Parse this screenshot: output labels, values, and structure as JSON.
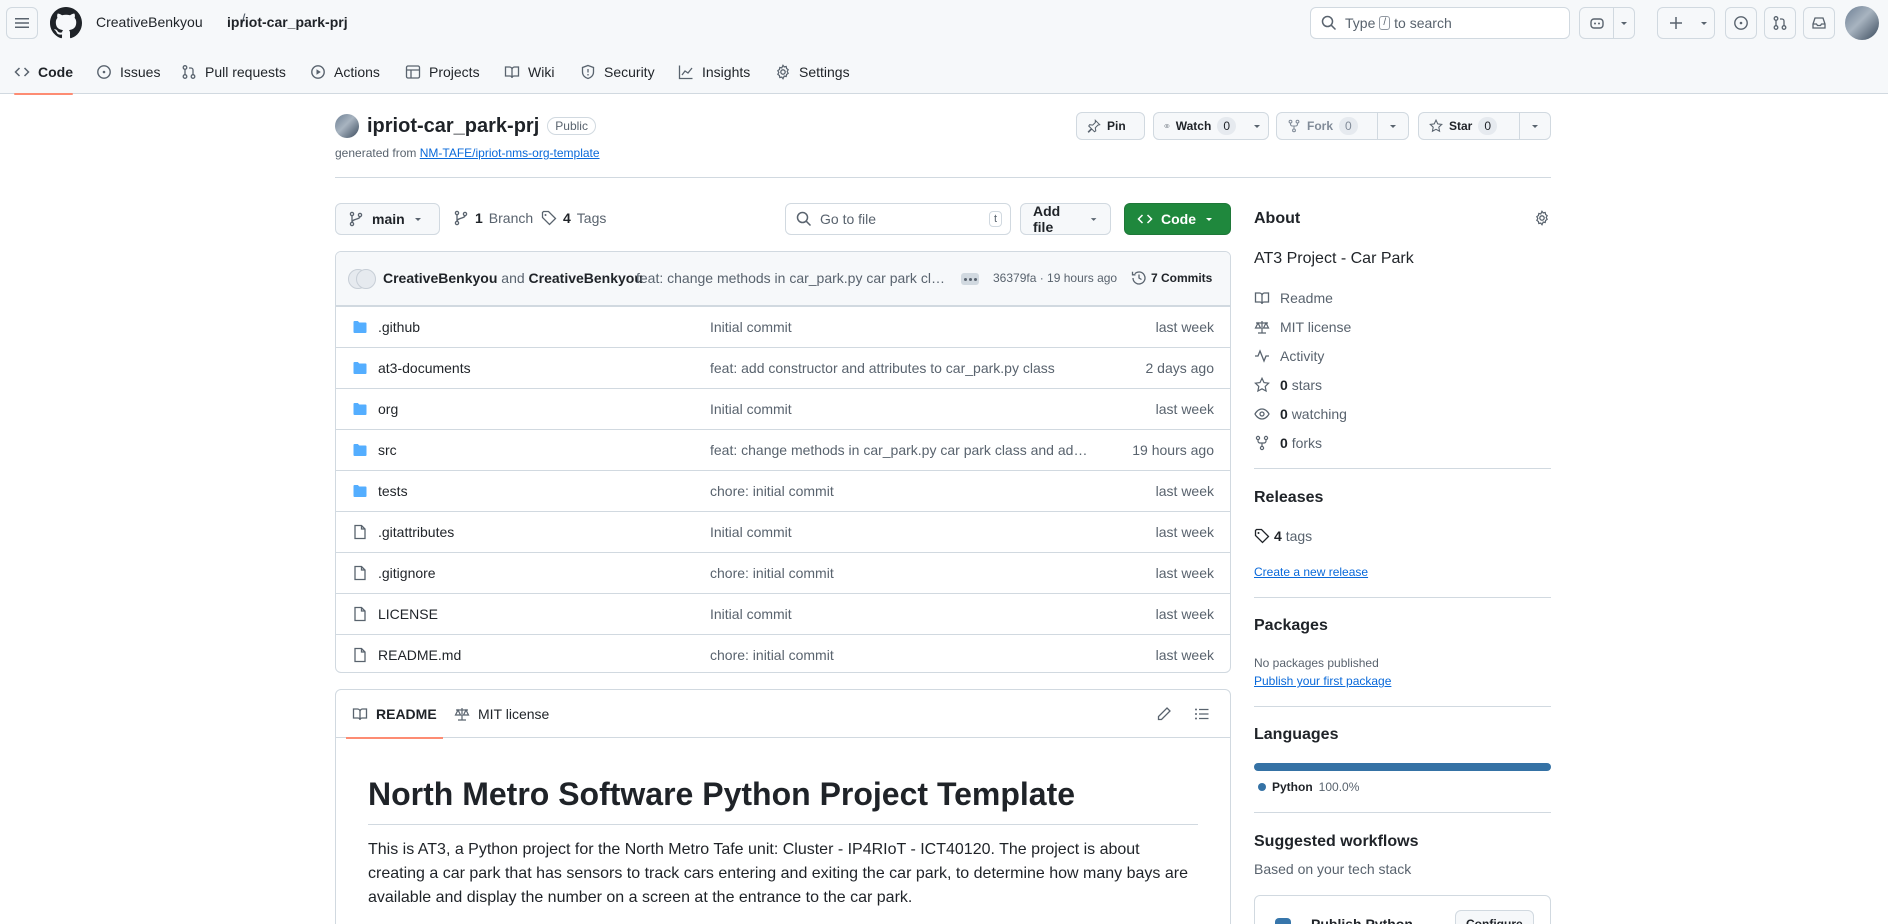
{
  "header": {
    "owner": "CreativeBenkyou",
    "separator": "/",
    "repo": "ipriot-car_park-prj",
    "search_prefix": "Type",
    "search_key": "/",
    "search_suffix": "to search"
  },
  "tabs": [
    {
      "label": "Code",
      "icon": "code-icon"
    },
    {
      "label": "Issues",
      "icon": "issue-icon"
    },
    {
      "label": "Pull requests",
      "icon": "pull-request-icon"
    },
    {
      "label": "Actions",
      "icon": "play-icon"
    },
    {
      "label": "Projects",
      "icon": "table-icon"
    },
    {
      "label": "Wiki",
      "icon": "book-icon"
    },
    {
      "label": "Security",
      "icon": "shield-icon"
    },
    {
      "label": "Insights",
      "icon": "graph-icon"
    },
    {
      "label": "Settings",
      "icon": "gear-icon"
    }
  ],
  "repo": {
    "name": "ipriot-car_park-prj",
    "visibility": "Public",
    "generated_prefix": "generated from",
    "generated_link": "NM-TAFE/ipriot-nms-org-template",
    "pin_label": "Pin",
    "watch_label": "Watch",
    "watch_count": "0",
    "fork_label": "Fork",
    "fork_count": "0",
    "star_label": "Star",
    "star_count": "0"
  },
  "nav": {
    "branch": "main",
    "branches_count": "1",
    "branches_label": "Branch",
    "tags_count": "4",
    "tags_label": "Tags",
    "goto_placeholder": "Go to file",
    "goto_key": "t",
    "add_file": "Add file",
    "code_button": "Code"
  },
  "commit": {
    "author1": "CreativeBenkyou",
    "and": "and",
    "author2": "CreativeBenkyou",
    "message": "feat: change methods in car_park.py car park class and add",
    "hash_time": "36379fa · 19 hours ago",
    "commits_count": "7 Commits"
  },
  "files": [
    {
      "type": "dir",
      "name": ".github",
      "message": "Initial commit",
      "time": "last week"
    },
    {
      "type": "dir",
      "name": "at3-documents",
      "message": "feat: add constructor and attributes to car_park.py class",
      "time": "2 days ago"
    },
    {
      "type": "dir",
      "name": "org",
      "message": "Initial commit",
      "time": "last week"
    },
    {
      "type": "dir",
      "name": "src",
      "message": "feat: change methods in car_park.py car park class and add functions",
      "time": "19 hours ago"
    },
    {
      "type": "dir",
      "name": "tests",
      "message": "chore: initial commit",
      "time": "last week"
    },
    {
      "type": "file",
      "name": ".gitattributes",
      "message": "Initial commit",
      "time": "last week"
    },
    {
      "type": "file",
      "name": ".gitignore",
      "message": "chore: initial commit",
      "time": "last week"
    },
    {
      "type": "file",
      "name": "LICENSE",
      "message": "Initial commit",
      "time": "last week"
    },
    {
      "type": "file",
      "name": "README.md",
      "message": "chore: initial commit",
      "time": "last week"
    }
  ],
  "readme": {
    "tab_readme": "README",
    "tab_license": "MIT license",
    "title": "North Metro Software Python Project Template",
    "body": "This is AT3, a Python project for the North Metro Tafe unit: Cluster - IP4RIoT - ICT40120. The project is about creating a car park that has sensors to track cars entering and exiting the car park, to determine how many bays are available and display the number on a screen at the entrance to the car park."
  },
  "about": {
    "title": "About",
    "description": "AT3 Project - Car Park",
    "readme": "Readme",
    "license": "MIT license",
    "activity": "Activity",
    "stars_count": "0",
    "stars_label": "stars",
    "watching_count": "0",
    "watching_label": "watching",
    "forks_count": "0",
    "forks_label": "forks"
  },
  "releases": {
    "title": "Releases",
    "tags_count": "4",
    "tags_label": "tags",
    "create_link": "Create a new release"
  },
  "packages": {
    "title": "Packages",
    "none": "No packages published",
    "publish_link": "Publish your first package"
  },
  "languages": {
    "title": "Languages",
    "items": [
      {
        "name": "Python",
        "percent": "100.0%",
        "color": "#3572A5",
        "share": 1.0
      }
    ]
  },
  "workflows": {
    "title": "Suggested workflows",
    "subtitle": "Based on your tech stack",
    "card_title": "Publish Python",
    "card_button": "Configure"
  },
  "colors": {
    "accent": "#fd8c73",
    "primary_button": "#1f883d",
    "link": "#0969da",
    "folder": "#54aeff"
  }
}
